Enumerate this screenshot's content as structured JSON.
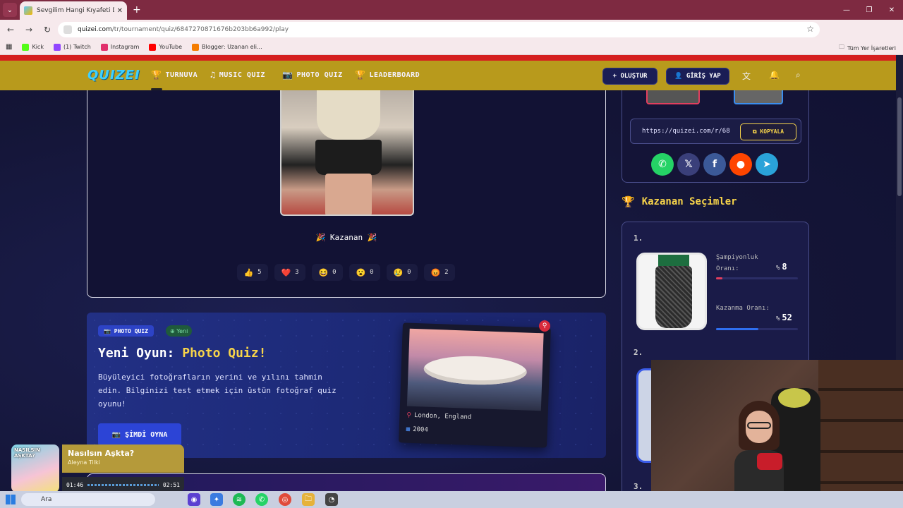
{
  "browser": {
    "tab_title": "Sevgilim Hangi Kıyafeti Değerlendiriyor",
    "tab_close": "✕",
    "new_tab": "+",
    "url_domain": "quizei.com",
    "url_path": "/tr/tournament/quiz/6847270871676b203bb6a992/play",
    "bookmarks": [
      {
        "label": "Kick",
        "color": "#53fc18"
      },
      {
        "label": "(1) Twitch",
        "color": "#9146ff"
      },
      {
        "label": "Instagram",
        "color": "#e1306c"
      },
      {
        "label": "YouTube",
        "color": "#ff0000"
      },
      {
        "label": "Blogger: Uzanan eli...",
        "color": "#f57d00"
      }
    ],
    "bookmarks_right": "Tüm Yer İşaretleri"
  },
  "site": {
    "logo": "QUIZEI",
    "nav": [
      {
        "label": "TURNUVA",
        "icon": "🏆"
      },
      {
        "label": "MUSIC QUIZ",
        "icon": "♫"
      },
      {
        "label": "PHOTO QUIZ",
        "icon": "📷"
      },
      {
        "label": "LEADERBOARD",
        "icon": "🏆"
      }
    ],
    "create_label": "+ OLUŞTUR",
    "login_label": "👤 GİRİŞ YAP"
  },
  "result": {
    "winner_label": "🎉  Kazanan  🎉",
    "reactions": [
      {
        "emoji": "👍",
        "count": "5"
      },
      {
        "emoji": "❤️",
        "count": "3"
      },
      {
        "emoji": "😆",
        "count": "0"
      },
      {
        "emoji": "😮",
        "count": "0"
      },
      {
        "emoji": "😢",
        "count": "0"
      },
      {
        "emoji": "😡",
        "count": "2"
      }
    ]
  },
  "promo": {
    "badge": "📷 PHOTO QUIZ",
    "new_badge": "⊕ Yeni",
    "title_prefix": "Yeni Oyun: ",
    "title_highlight": "Photo Quiz!",
    "description": "Büyüleyici fotoğrafların yerini ve yılını tahmin edin. Bilginizi test etmek için üstün fotoğraf quiz oyunu!",
    "button": "📷 ŞİMDİ OYNA",
    "photo_location": "London, England",
    "photo_year": "2004"
  },
  "share": {
    "link": "https://quizei.com/r/68",
    "copy_label": "⧉ KOPYALA",
    "socials": [
      {
        "name": "whatsapp",
        "glyph": "✆",
        "color": "#25d366"
      },
      {
        "name": "x",
        "glyph": "𝕏",
        "color": "#3a3f7a"
      },
      {
        "name": "facebook",
        "glyph": "f",
        "color": "#3b5998"
      },
      {
        "name": "reddit",
        "glyph": "●",
        "color": "#ff4500"
      },
      {
        "name": "telegram",
        "glyph": "➤",
        "color": "#2aa3d9"
      }
    ]
  },
  "winners": {
    "title": "Kazanan Seçimler",
    "items": [
      {
        "rank": "1.",
        "champ_label": "Şampiyonluk Oranı:",
        "champ_value": "8",
        "champ_fill": 0.08,
        "champ_color": "#e23e5e",
        "win_label": "Kazanma Oranı:",
        "win_value": "52",
        "win_fill": 0.52,
        "win_color": "#2f6ff0",
        "percent_sign": "%"
      },
      {
        "rank": "2."
      },
      {
        "rank": "3."
      }
    ]
  },
  "music": {
    "cover_text": "NASILSIN AŞKTA?",
    "song": "Nasılsın Aşkta?",
    "artist": "Aleyna Tilki",
    "elapsed": "01:46",
    "duration": "02:51"
  },
  "taskbar": {
    "search": "Ara"
  }
}
